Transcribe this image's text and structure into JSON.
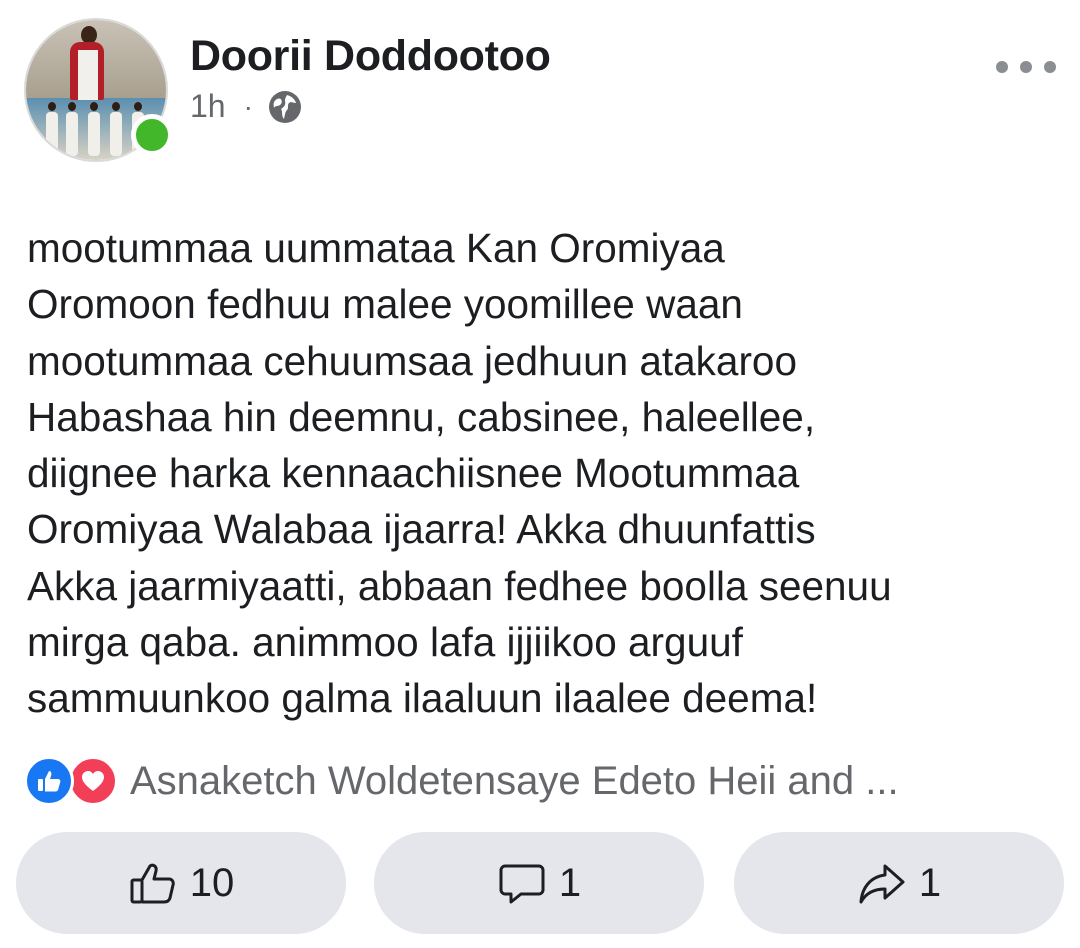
{
  "post": {
    "author": "Doorii Doddootoo",
    "time": "1h",
    "separator": "·",
    "audience_icon": "globe-icon",
    "text": "mootummaa uummataa Kan Oromiyaa\nOromoon fedhuu malee yoomillee waan\nmootummaa cehuumsaa jedhuun atakaroo\nHabashaa hin deemnu, cabsinee, haleellee,\ndiignee harka kennaachiisnee Mootummaa\nOromiyaa Walabaa ijaarra! Akka dhuunfattis\nAkka jaarmiyaatti, abbaan fedhee boolla seenuu\nmirga qaba. animmoo lafa ijjiikoo arguuf\nsammuunkoo galma ilaaluun ilaalee deema!"
  },
  "reactions": {
    "icons": [
      "like-icon",
      "love-icon"
    ],
    "summary": "Asnaketch Woldetensaye Edeto Heii and ..."
  },
  "actions": {
    "like_count": "10",
    "comment_count": "1",
    "share_count": "1"
  },
  "colors": {
    "online": "#42b72a",
    "like_blue": "#1877f2",
    "love_red": "#f33e58",
    "button_bg": "#e4e6eb",
    "meta_gray": "#65676b"
  }
}
